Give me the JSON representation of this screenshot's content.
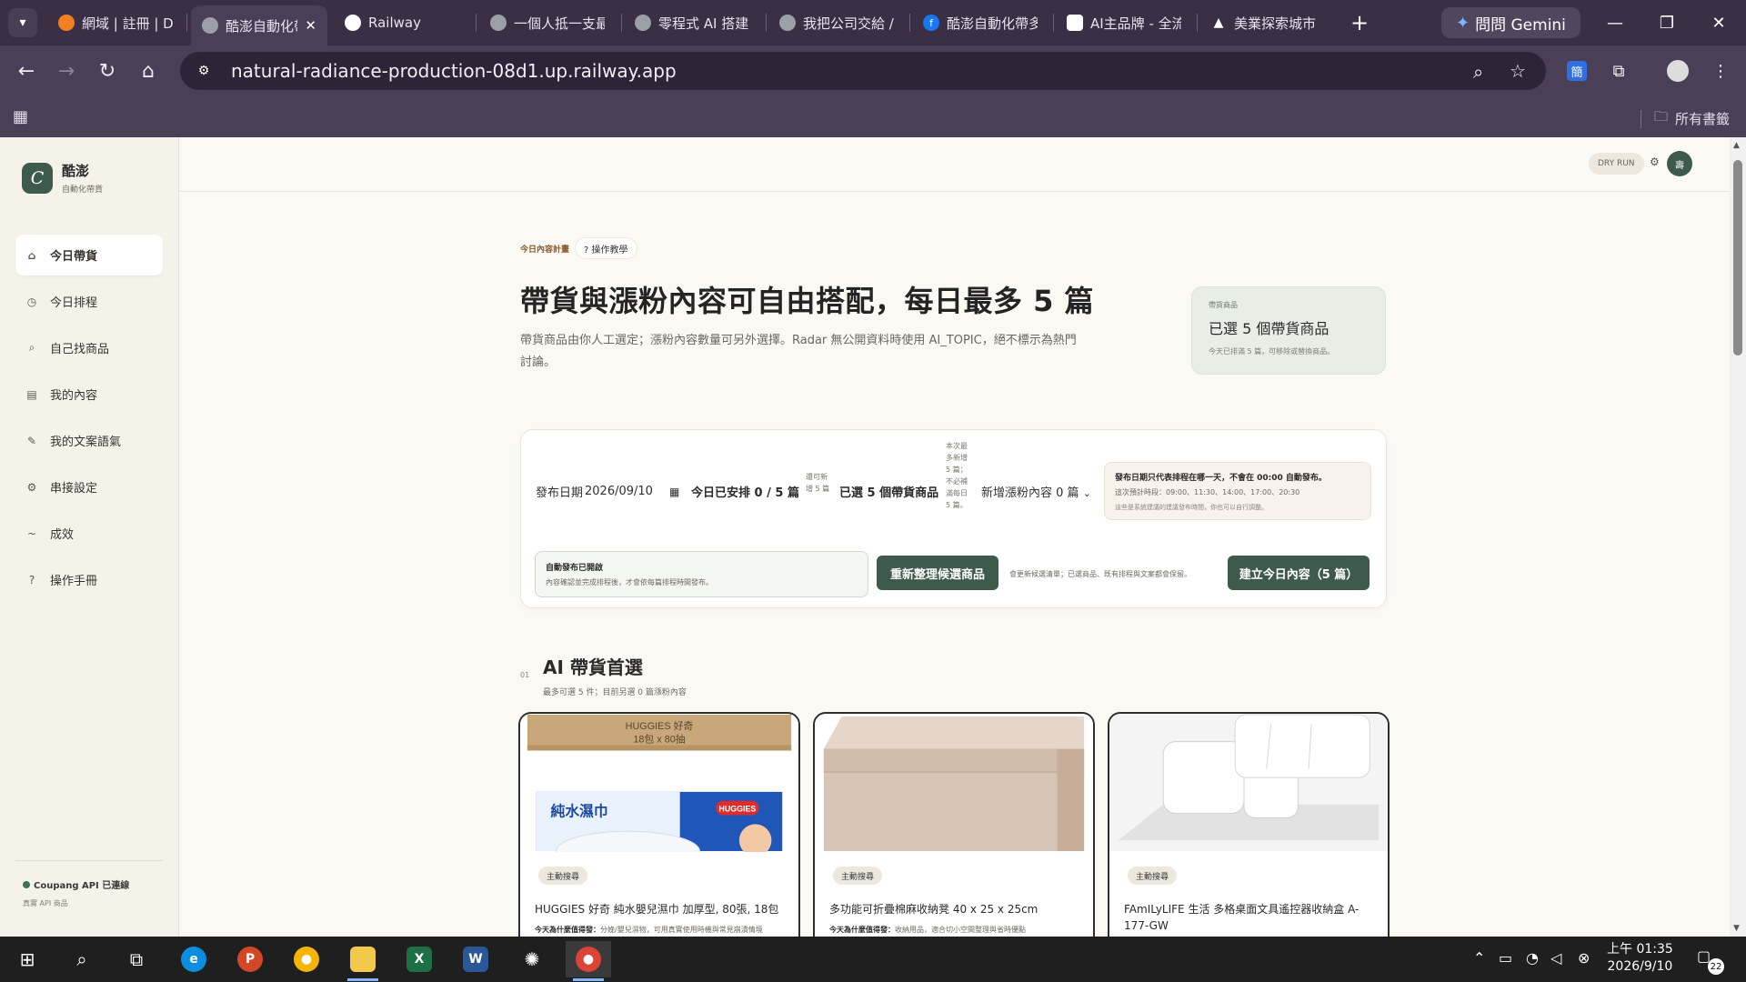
{
  "browser": {
    "tabs": [
      {
        "title": "網域 | 註冊 | Dc",
        "icon": "cloudflare-icon",
        "color": "#f38020"
      },
      {
        "title": "酷澎自動化帶",
        "icon": "globe-icon",
        "color": "#9aa0a6",
        "active": true
      },
      {
        "title": "Railway",
        "icon": "railway-icon",
        "color": "#ffffff"
      },
      {
        "title": "一個人抵一支最",
        "icon": "globe-icon",
        "color": "#9aa0a6"
      },
      {
        "title": "零程式 AI 搭建",
        "icon": "globe-icon",
        "color": "#9aa0a6"
      },
      {
        "title": "我把公司交給 /",
        "icon": "globe-icon",
        "color": "#9aa0a6"
      },
      {
        "title": "酷澎自動化帶多",
        "icon": "facebook-icon",
        "color": "#1877f2"
      },
      {
        "title": "AI主品牌 - 全流",
        "icon": "chatgpt-icon",
        "color": "#ffffff"
      },
      {
        "title": "美業探索城市",
        "icon": "vercel-icon",
        "color": "#ffffff"
      }
    ],
    "gemini_label": "問問 Gemini",
    "url": "natural-radiance-production-08d1.up.railway.app",
    "ext_label": "簡",
    "all_bookmarks": "所有書籤"
  },
  "sidebar": {
    "brand_letter": "C",
    "brand_name": "酷澎",
    "brand_sub": "自動化帶貨",
    "items": [
      {
        "label": "今日帶貨",
        "icon": "home-icon",
        "glyph": "⌂",
        "active": true
      },
      {
        "label": "今日排程",
        "icon": "clock-icon",
        "glyph": "◷"
      },
      {
        "label": "自己找商品",
        "icon": "search-icon",
        "glyph": "⌕"
      },
      {
        "label": "我的內容",
        "icon": "document-icon",
        "glyph": "▤"
      },
      {
        "label": "我的文案語氣",
        "icon": "pen-icon",
        "glyph": "✎"
      },
      {
        "label": "串接設定",
        "icon": "gear-icon",
        "glyph": "⚙"
      },
      {
        "label": "成效",
        "icon": "trend-icon",
        "glyph": "~"
      },
      {
        "label": "操作手冊",
        "icon": "help-icon",
        "glyph": "?"
      }
    ],
    "status": "Coupang API 已連線",
    "status_sub": "真實 API 商品"
  },
  "topbar": {
    "dry_run": "DRY RUN",
    "avatar": "壽"
  },
  "main": {
    "kicker": "今日內容計畫",
    "help_label": "? 操作教學",
    "title": "帶貨與漲粉內容可自由搭配，每日最多 5 篇",
    "lead": "帶貨商品由你人工選定；漲粉內容數量可另外選擇。Radar 無公開資料時使用 AI_TOPIC，絕不標示為熱門討論。",
    "pick_card": {
      "label": "帶貨商品",
      "big": "已選 5 個帶貨商品",
      "small": "今天已排滿 5 篇，可移除或替換商品。"
    },
    "panel": {
      "date_label": "發布日期",
      "date_value": "2026/09/10",
      "scheduled": "今日已安排 0 / 5 篇",
      "note1": "還可新增 5 篇",
      "chosen": "已選 5 個帶貨商品",
      "note2": "本次最多新增 5 篇；不必補滿每日 5 篇。",
      "add_select": "新增漲粉內容 0 篇",
      "info_title": "發布日期只代表排程在哪一天，不會在 00:00 自動發布。",
      "info_line": "這次預計時段：09:00、11:30、14:00、17:00、20:30",
      "info_sub": "這些是系統建議的建議發布時間，你也可以自行調整。",
      "auto_title": "自動發布已開啟",
      "auto_sub": "內容確認並完成排程後，才會依每篇排程時間發布。",
      "refresh_btn": "重新整理候選商品",
      "refresh_note": "會更新候選清單；已選商品、既有排程與文案都會保留。",
      "build_btn": "建立今日內容（5 篇）"
    },
    "section": {
      "num": "01",
      "title": "AI 帶貨首選",
      "sub": "最多可選 5 件；目前另選 0 篇漲粉內容"
    },
    "products": [
      {
        "badge": "主動搜尋",
        "name": "HUGGIES 好奇 純水嬰兒濕巾 加厚型, 80張, 18包",
        "why_label": "今天為什麼值得發：",
        "why": "分娩/嬰兒濕物，可用真實使用時機與常見崩潰情境"
      },
      {
        "badge": "主動搜尋",
        "name": "多功能可折疊棉麻收納凳 40 x 25 x 25cm",
        "why_label": "今天為什麼值得發：",
        "why": "收納用品，適合切小空間整理與省時優點"
      },
      {
        "badge": "主動搜尋",
        "name": "FAmILyLIFE 生活 多格桌面文具遙控器收納盒 A-177-GW",
        "why_label": "",
        "why": ""
      }
    ],
    "product_img_text": {
      "box_text": "HUGGIES 好奇",
      "box_count": "18包 x 80抽",
      "pack_text": "純水濕巾",
      "brand": "HUGGIES"
    }
  },
  "taskbar": {
    "apps": [
      "start",
      "search",
      "taskview",
      "edge",
      "powerpoint",
      "chrome",
      "explorer",
      "excel",
      "word",
      "chatgpt",
      "chrome-active"
    ],
    "time": "上午 01:35",
    "date": "2026/9/10",
    "notifications": "22"
  }
}
